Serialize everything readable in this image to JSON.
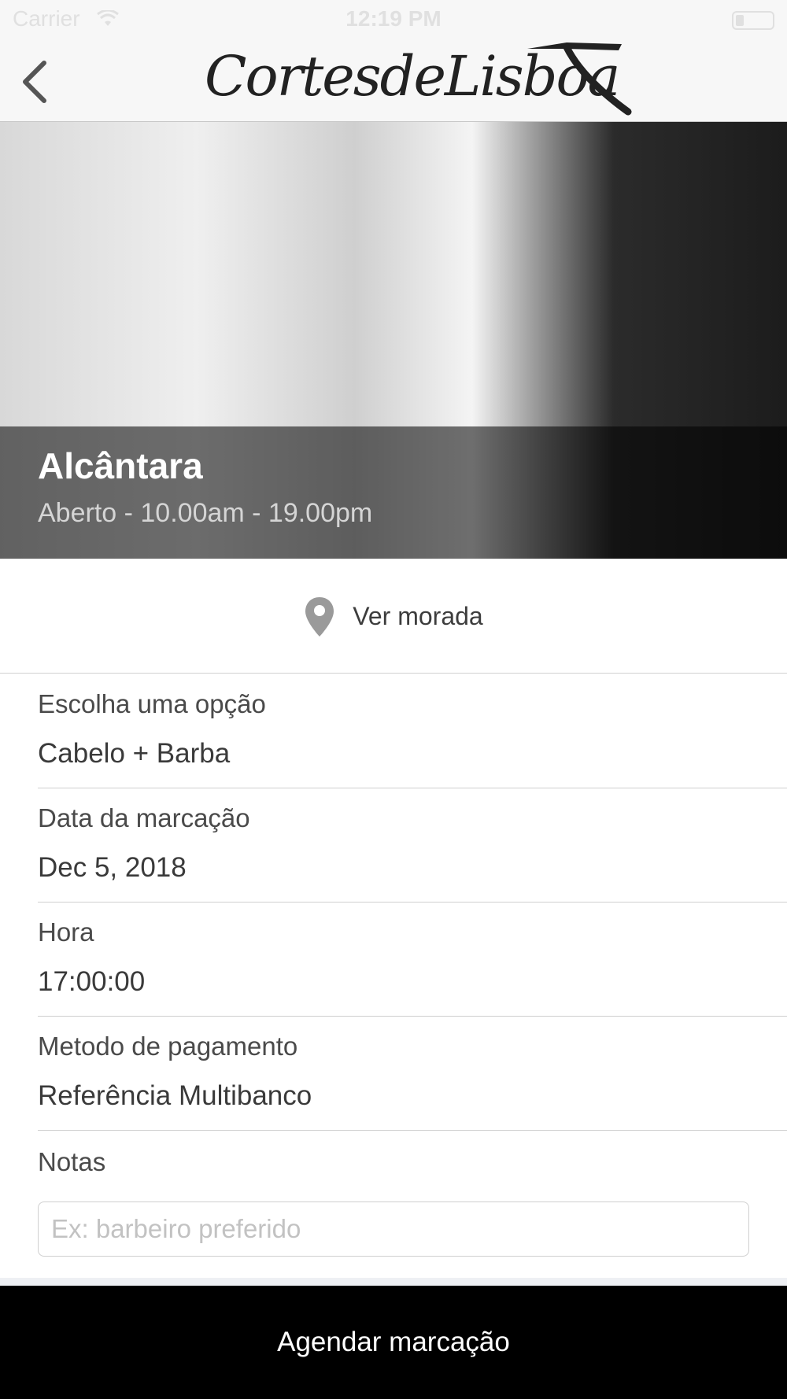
{
  "status_bar": {
    "carrier": "Carrier",
    "time": "12:19 PM"
  },
  "header": {
    "logo_text": "CortesdeLisboa",
    "back_icon": "chevron-left-icon"
  },
  "hero": {
    "location_name": "Alcântara",
    "hours": "Aberto - 10.00am - 19.00pm"
  },
  "address": {
    "label": "Ver morada",
    "icon": "map-pin-icon"
  },
  "form": {
    "fields": [
      {
        "label": "Escolha uma opção",
        "value": "Cabelo + Barba"
      },
      {
        "label": "Data da marcação",
        "value": "Dec 5, 2018"
      },
      {
        "label": "Hora",
        "value": "17:00:00"
      },
      {
        "label": "Metodo de pagamento",
        "value": "Referência Multibanco"
      }
    ],
    "notes": {
      "label": "Notas",
      "placeholder": "Ex: barbeiro preferido",
      "value": ""
    }
  },
  "cta": {
    "label": "Agendar marcação"
  },
  "colors": {
    "cta_bg": "#000000",
    "cta_text": "#ffffff",
    "nav_bg": "#f7f7f7",
    "divider": "#cfcfcf"
  }
}
